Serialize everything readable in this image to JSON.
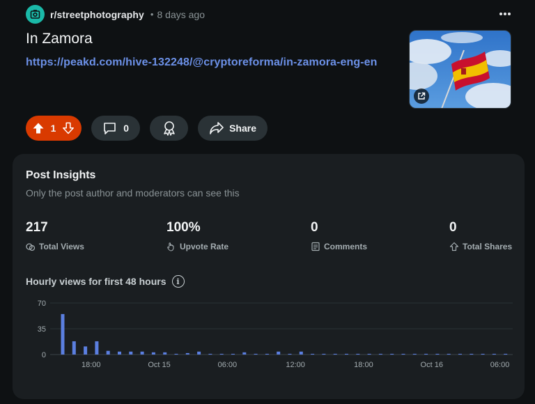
{
  "post": {
    "subreddit": "r/streetphotography",
    "separator": "•",
    "age": "8 days ago",
    "title": "In Zamora",
    "link": "https://peakd.com/hive-132248/@cryptoreforma/in-zamora-eng-en"
  },
  "actions": {
    "upvote_count": "1",
    "comment_count": "0",
    "share_label": "Share"
  },
  "insights": {
    "title": "Post Insights",
    "subtitle": "Only the post author and moderators can see this",
    "stats": [
      {
        "value": "217",
        "label": "Total Views",
        "icon": "views-icon"
      },
      {
        "value": "100%",
        "label": "Upvote Rate",
        "icon": "upvote-hand-icon"
      },
      {
        "value": "0",
        "label": "Comments",
        "icon": "comments-icon"
      },
      {
        "value": "0",
        "label": "Total Shares",
        "icon": "share-icon"
      }
    ],
    "chart_title": "Hourly views for first 48 hours"
  },
  "colors": {
    "accent": "#d93a00",
    "link": "#6c91e8",
    "bar": "#5b7fe0",
    "subreddit_avatar": "#1ab9a8"
  },
  "chart_data": {
    "type": "bar",
    "title": "Hourly views for first 48 hours",
    "ylim": [
      0,
      70
    ],
    "y_ticks": [
      "0",
      "35",
      "70"
    ],
    "x_tick_labels": [
      "18:00",
      "Oct 15",
      "06:00",
      "12:00",
      "18:00",
      "Oct 16",
      "06:00"
    ],
    "x_tick_hours": [
      2.5,
      8.5,
      14.5,
      20.5,
      26.5,
      32.5,
      38.5
    ],
    "values": [
      55,
      18,
      11,
      18,
      5,
      4,
      4,
      4,
      3,
      3,
      1,
      2,
      4,
      1,
      1,
      1,
      3,
      1,
      1,
      4,
      1,
      4,
      1,
      1,
      1,
      1,
      1,
      1,
      1,
      1,
      1,
      1,
      1,
      1,
      1,
      1,
      1,
      1,
      1,
      1,
      1,
      1,
      1,
      1
    ],
    "grid": true
  }
}
